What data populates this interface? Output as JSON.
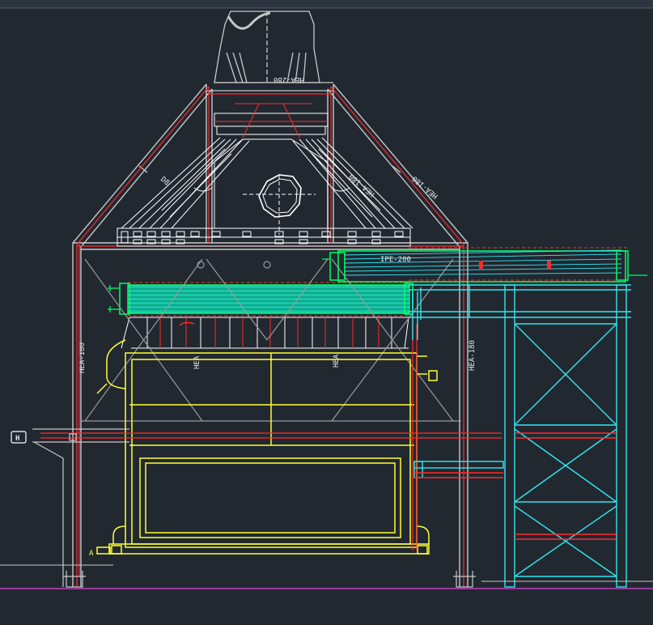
{
  "drawing": {
    "labels": {
      "top_beam": "HEA-280",
      "left_diag": "D8",
      "right_diag": "HEA-180",
      "right_diag_inner": "HEA-180",
      "conveyor_beam": "IPE-200",
      "left_column": "HEA-180",
      "right_column": "HEA-180",
      "mid_left": "HEA",
      "mid_right": "HEA",
      "section_marker": "A",
      "side_marker": "H"
    },
    "colors": {
      "background": "#212830",
      "structure": "#c8c8c8",
      "red": "#ff2a2a",
      "yellow": "#ffff33",
      "cyan": "#33e6f0",
      "green": "#00ff66",
      "teal_fill": "#18c8a8",
      "white": "#ffffff",
      "magenta": "#c040c0"
    }
  }
}
